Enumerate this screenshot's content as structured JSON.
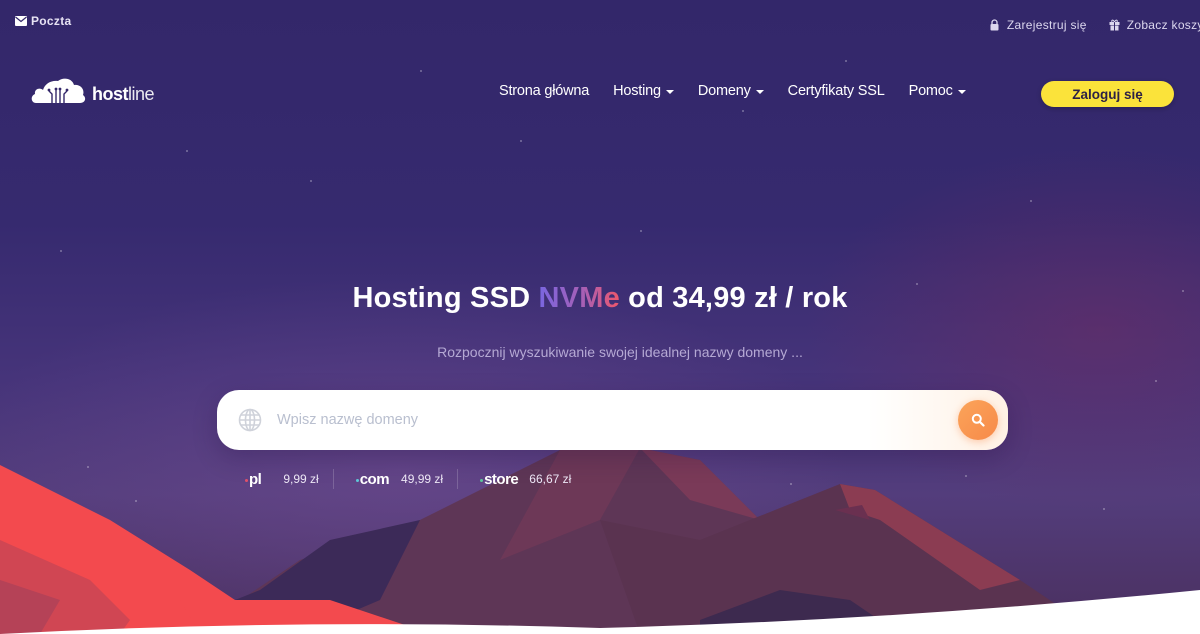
{
  "topbar": {
    "mail": {
      "icon": "envelope-icon",
      "label": "Poczta"
    },
    "register": {
      "icon": "lock-icon",
      "label": "Zarejestruj się"
    },
    "cart": {
      "icon": "gift-icon",
      "label": "Zobacz koszyk"
    }
  },
  "logo": {
    "bold": "host",
    "light": "line"
  },
  "nav": {
    "items": [
      {
        "label": "Strona główna",
        "dropdown": false
      },
      {
        "label": "Hosting",
        "dropdown": true
      },
      {
        "label": "Domeny",
        "dropdown": true
      },
      {
        "label": "Certyfikaty SSL",
        "dropdown": false
      },
      {
        "label": "Pomoc",
        "dropdown": true
      }
    ],
    "login_label": "Zaloguj się"
  },
  "hero": {
    "headline_prefix": "Hosting SSD",
    "headline_highlight": "NVMe",
    "headline_suffix": "od 34,99 zł / rok",
    "subline": "Rozpocznij wyszukiwanie swojej idealnej nazwy domeny ..."
  },
  "search": {
    "placeholder": "Wpisz nazwę domeny",
    "value": ""
  },
  "tlds": [
    {
      "name": "pl",
      "price": "9,99 zł",
      "dot_color": "#e0506a"
    },
    {
      "name": "com",
      "price": "49,99 zł",
      "dot_color": "#5ec7d8"
    },
    {
      "name": "store",
      "price": "66,67 zł",
      "dot_color": "#5ec79a"
    }
  ],
  "colors": {
    "accent_yellow": "#fbe33a",
    "search_orange": "#f78a49",
    "bg_purple": "#33276a",
    "mountain_red": "#f34a4e"
  }
}
